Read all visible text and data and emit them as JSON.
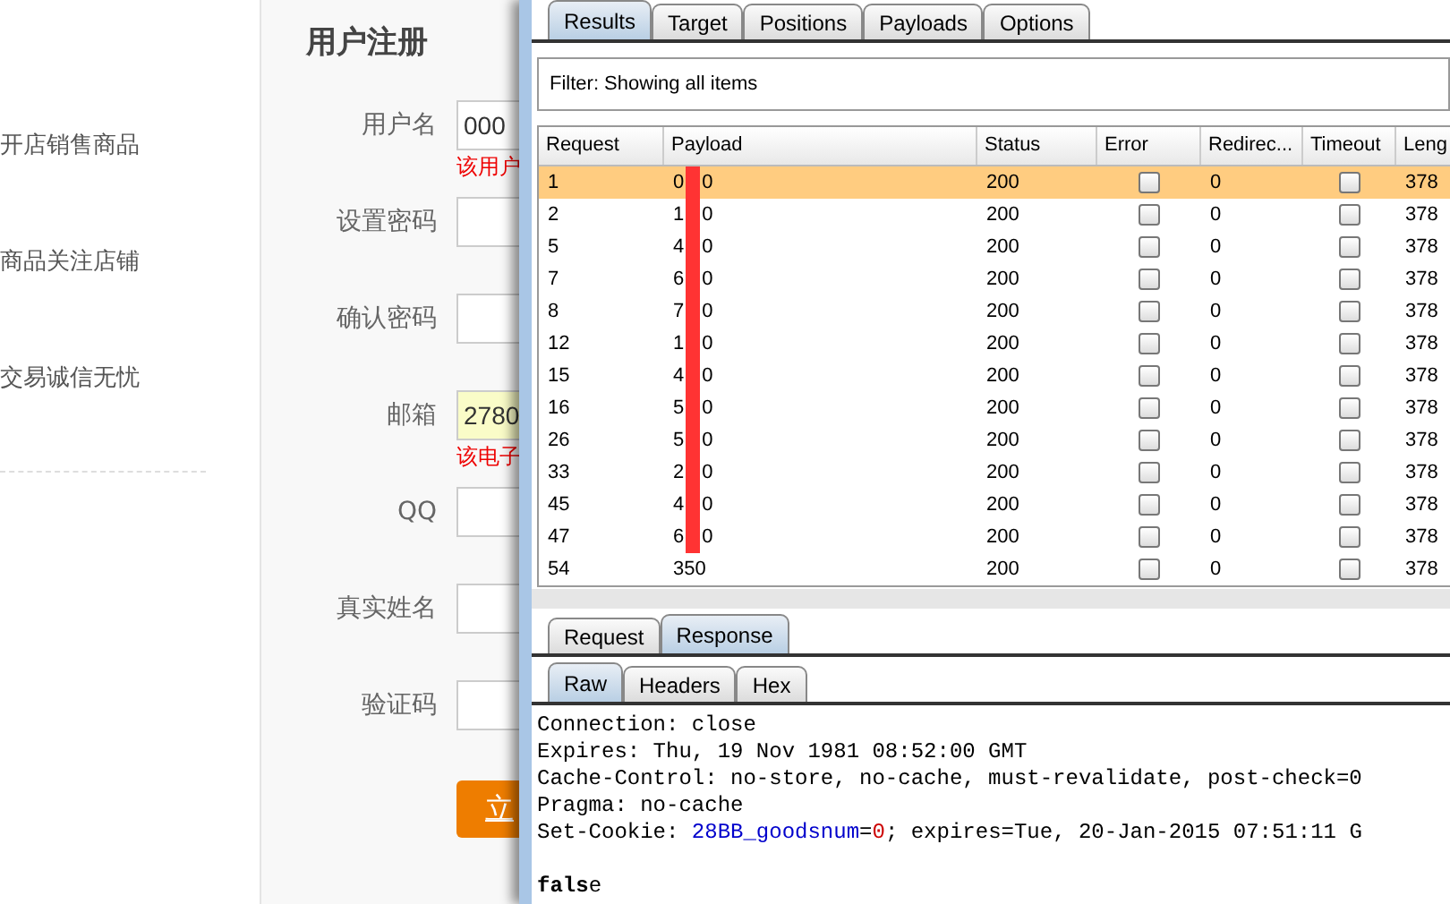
{
  "site": {
    "features": [
      "开店销售商品",
      "商品关注店铺",
      "交易诚信无忧"
    ]
  },
  "register": {
    "title": "用户注册",
    "fields": [
      {
        "label": "用户名",
        "value": "000",
        "error": "该用户",
        "highlighted": false
      },
      {
        "label": "设置密码",
        "highlighted": false
      },
      {
        "label": "确认密码",
        "highlighted": false
      },
      {
        "label": "邮箱",
        "value": "2780",
        "error": "该电子",
        "highlighted": true
      },
      {
        "label": "QQ",
        "highlighted": false
      },
      {
        "label": "真实姓名",
        "highlighted": false
      },
      {
        "label": "验证码",
        "highlighted": false
      }
    ],
    "submit": "立"
  },
  "intruder": {
    "tabs": [
      {
        "label": "Results",
        "selected": true
      },
      {
        "label": "Target",
        "selected": false
      },
      {
        "label": "Positions",
        "selected": false
      },
      {
        "label": "Payloads",
        "selected": false
      },
      {
        "label": "Options",
        "selected": false
      }
    ],
    "filter": "Filter:  Showing all items",
    "columns": [
      "Request",
      "Payload",
      "Status",
      "Error",
      "Redirec...",
      "Timeout",
      "Leng"
    ],
    "rows": [
      {
        "request": "1",
        "payload": "0",
        "payload_tail": "0",
        "redacted": true,
        "status": "200",
        "error": false,
        "redirects": "0",
        "timeout": false,
        "length": "378",
        "selected": true
      },
      {
        "request": "2",
        "payload": "1",
        "payload_tail": "0",
        "redacted": true,
        "status": "200",
        "error": false,
        "redirects": "0",
        "timeout": false,
        "length": "378",
        "selected": false
      },
      {
        "request": "5",
        "payload": "4",
        "payload_tail": "0",
        "redacted": true,
        "status": "200",
        "error": false,
        "redirects": "0",
        "timeout": false,
        "length": "378",
        "selected": false
      },
      {
        "request": "7",
        "payload": "6",
        "payload_tail": "0",
        "redacted": true,
        "status": "200",
        "error": false,
        "redirects": "0",
        "timeout": false,
        "length": "378",
        "selected": false
      },
      {
        "request": "8",
        "payload": "7",
        "payload_tail": "0",
        "redacted": true,
        "status": "200",
        "error": false,
        "redirects": "0",
        "timeout": false,
        "length": "378",
        "selected": false
      },
      {
        "request": "12",
        "payload": "1",
        "payload_tail": "0",
        "redacted": true,
        "status": "200",
        "error": false,
        "redirects": "0",
        "timeout": false,
        "length": "378",
        "selected": false
      },
      {
        "request": "15",
        "payload": "4",
        "payload_tail": "0",
        "redacted": true,
        "status": "200",
        "error": false,
        "redirects": "0",
        "timeout": false,
        "length": "378",
        "selected": false
      },
      {
        "request": "16",
        "payload": "5",
        "payload_tail": "0",
        "redacted": true,
        "status": "200",
        "error": false,
        "redirects": "0",
        "timeout": false,
        "length": "378",
        "selected": false
      },
      {
        "request": "26",
        "payload": "5",
        "payload_tail": "0",
        "redacted": true,
        "status": "200",
        "error": false,
        "redirects": "0",
        "timeout": false,
        "length": "378",
        "selected": false
      },
      {
        "request": "33",
        "payload": "2",
        "payload_tail": "0",
        "redacted": true,
        "status": "200",
        "error": false,
        "redirects": "0",
        "timeout": false,
        "length": "378",
        "selected": false
      },
      {
        "request": "45",
        "payload": "4",
        "payload_tail": "0",
        "redacted": true,
        "status": "200",
        "error": false,
        "redirects": "0",
        "timeout": false,
        "length": "378",
        "selected": false
      },
      {
        "request": "47",
        "payload": "6",
        "payload_tail": "0",
        "redacted": true,
        "status": "200",
        "error": false,
        "redirects": "0",
        "timeout": false,
        "length": "378",
        "selected": false
      },
      {
        "request": "54",
        "payload": "350",
        "redacted": false,
        "status": "200",
        "error": false,
        "redirects": "0",
        "timeout": false,
        "length": "378",
        "selected": false
      }
    ],
    "message_tabs": [
      {
        "label": "Request",
        "selected": false
      },
      {
        "label": "Response",
        "selected": true
      }
    ],
    "view_tabs": [
      {
        "label": "Raw",
        "selected": true
      },
      {
        "label": "Headers",
        "selected": false
      },
      {
        "label": "Hex",
        "selected": false
      }
    ],
    "response_lines": [
      {
        "kind": "plain",
        "text": "Connection: close"
      },
      {
        "kind": "plain",
        "text": "Expires: Thu, 19 Nov 1981 08:52:00 GMT"
      },
      {
        "kind": "plain",
        "text": "Cache-Control: no-store, no-cache, must-revalidate, post-check=0"
      },
      {
        "kind": "plain",
        "text": "Pragma: no-cache"
      },
      {
        "kind": "cookie",
        "parts": [
          "Set-Cookie: ",
          "28BB_goodsnum",
          "=",
          "0",
          "; expires=Tue, 20-Jan-2015 07:51:11 G"
        ]
      },
      {
        "kind": "blank"
      },
      {
        "kind": "body",
        "text": "**fals**e"
      }
    ]
  }
}
